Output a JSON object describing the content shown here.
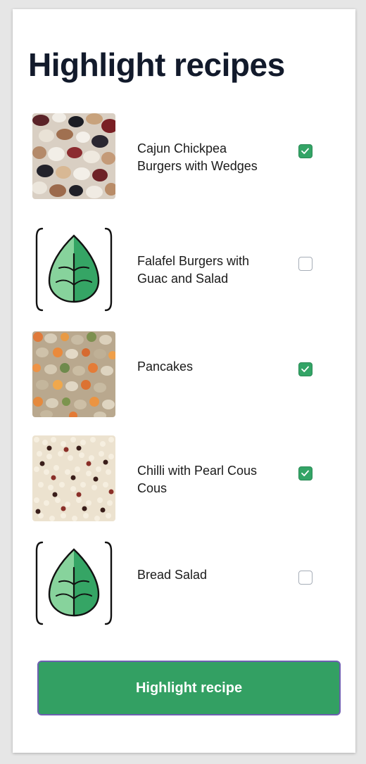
{
  "header": {
    "title": "Highlight recipes"
  },
  "recipes": [
    {
      "name": "Cajun Chickpea Burgers with Wedges",
      "checked": true,
      "thumbnail": "beans-photo"
    },
    {
      "name": "Falafel Burgers with Guac and Salad",
      "checked": false,
      "thumbnail": "leaf-icon"
    },
    {
      "name": "Pancakes",
      "checked": true,
      "thumbnail": "lentils-photo"
    },
    {
      "name": "Chilli with Pearl Cous Cous",
      "checked": true,
      "thumbnail": "quinoa-photo"
    },
    {
      "name": "Bread Salad",
      "checked": false,
      "thumbnail": "leaf-icon"
    }
  ],
  "footer": {
    "button_label": "Highlight recipe"
  },
  "colors": {
    "accent": "#33a063",
    "check": "#33a466",
    "title": "#121a2b",
    "button_border": "#6d5fb0"
  }
}
